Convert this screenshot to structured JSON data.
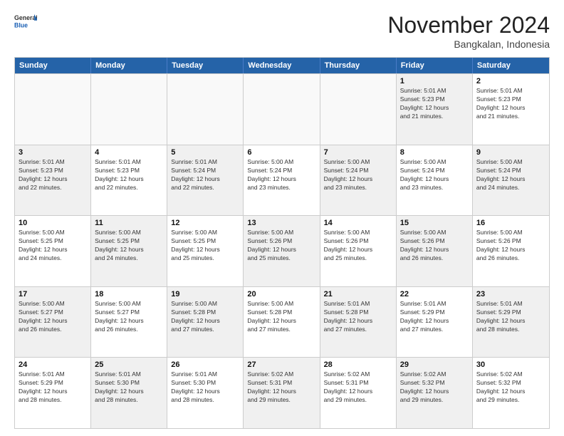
{
  "logo": {
    "general": "General",
    "blue": "Blue"
  },
  "title": "November 2024",
  "subtitle": "Bangkalan, Indonesia",
  "days": [
    "Sunday",
    "Monday",
    "Tuesday",
    "Wednesday",
    "Thursday",
    "Friday",
    "Saturday"
  ],
  "rows": [
    [
      {
        "num": "",
        "info": "",
        "empty": true
      },
      {
        "num": "",
        "info": "",
        "empty": true
      },
      {
        "num": "",
        "info": "",
        "empty": true
      },
      {
        "num": "",
        "info": "",
        "empty": true
      },
      {
        "num": "",
        "info": "",
        "empty": true
      },
      {
        "num": "1",
        "info": "Sunrise: 5:01 AM\nSunset: 5:23 PM\nDaylight: 12 hours\nand 21 minutes.",
        "shaded": true
      },
      {
        "num": "2",
        "info": "Sunrise: 5:01 AM\nSunset: 5:23 PM\nDaylight: 12 hours\nand 21 minutes.",
        "shaded": false
      }
    ],
    [
      {
        "num": "3",
        "info": "Sunrise: 5:01 AM\nSunset: 5:23 PM\nDaylight: 12 hours\nand 22 minutes.",
        "shaded": true
      },
      {
        "num": "4",
        "info": "Sunrise: 5:01 AM\nSunset: 5:23 PM\nDaylight: 12 hours\nand 22 minutes.",
        "shaded": false
      },
      {
        "num": "5",
        "info": "Sunrise: 5:01 AM\nSunset: 5:24 PM\nDaylight: 12 hours\nand 22 minutes.",
        "shaded": true
      },
      {
        "num": "6",
        "info": "Sunrise: 5:00 AM\nSunset: 5:24 PM\nDaylight: 12 hours\nand 23 minutes.",
        "shaded": false
      },
      {
        "num": "7",
        "info": "Sunrise: 5:00 AM\nSunset: 5:24 PM\nDaylight: 12 hours\nand 23 minutes.",
        "shaded": true
      },
      {
        "num": "8",
        "info": "Sunrise: 5:00 AM\nSunset: 5:24 PM\nDaylight: 12 hours\nand 23 minutes.",
        "shaded": false
      },
      {
        "num": "9",
        "info": "Sunrise: 5:00 AM\nSunset: 5:24 PM\nDaylight: 12 hours\nand 24 minutes.",
        "shaded": true
      }
    ],
    [
      {
        "num": "10",
        "info": "Sunrise: 5:00 AM\nSunset: 5:25 PM\nDaylight: 12 hours\nand 24 minutes.",
        "shaded": false
      },
      {
        "num": "11",
        "info": "Sunrise: 5:00 AM\nSunset: 5:25 PM\nDaylight: 12 hours\nand 24 minutes.",
        "shaded": true
      },
      {
        "num": "12",
        "info": "Sunrise: 5:00 AM\nSunset: 5:25 PM\nDaylight: 12 hours\nand 25 minutes.",
        "shaded": false
      },
      {
        "num": "13",
        "info": "Sunrise: 5:00 AM\nSunset: 5:26 PM\nDaylight: 12 hours\nand 25 minutes.",
        "shaded": true
      },
      {
        "num": "14",
        "info": "Sunrise: 5:00 AM\nSunset: 5:26 PM\nDaylight: 12 hours\nand 25 minutes.",
        "shaded": false
      },
      {
        "num": "15",
        "info": "Sunrise: 5:00 AM\nSunset: 5:26 PM\nDaylight: 12 hours\nand 26 minutes.",
        "shaded": true
      },
      {
        "num": "16",
        "info": "Sunrise: 5:00 AM\nSunset: 5:26 PM\nDaylight: 12 hours\nand 26 minutes.",
        "shaded": false
      }
    ],
    [
      {
        "num": "17",
        "info": "Sunrise: 5:00 AM\nSunset: 5:27 PM\nDaylight: 12 hours\nand 26 minutes.",
        "shaded": true
      },
      {
        "num": "18",
        "info": "Sunrise: 5:00 AM\nSunset: 5:27 PM\nDaylight: 12 hours\nand 26 minutes.",
        "shaded": false
      },
      {
        "num": "19",
        "info": "Sunrise: 5:00 AM\nSunset: 5:28 PM\nDaylight: 12 hours\nand 27 minutes.",
        "shaded": true
      },
      {
        "num": "20",
        "info": "Sunrise: 5:00 AM\nSunset: 5:28 PM\nDaylight: 12 hours\nand 27 minutes.",
        "shaded": false
      },
      {
        "num": "21",
        "info": "Sunrise: 5:01 AM\nSunset: 5:28 PM\nDaylight: 12 hours\nand 27 minutes.",
        "shaded": true
      },
      {
        "num": "22",
        "info": "Sunrise: 5:01 AM\nSunset: 5:29 PM\nDaylight: 12 hours\nand 27 minutes.",
        "shaded": false
      },
      {
        "num": "23",
        "info": "Sunrise: 5:01 AM\nSunset: 5:29 PM\nDaylight: 12 hours\nand 28 minutes.",
        "shaded": true
      }
    ],
    [
      {
        "num": "24",
        "info": "Sunrise: 5:01 AM\nSunset: 5:29 PM\nDaylight: 12 hours\nand 28 minutes.",
        "shaded": false
      },
      {
        "num": "25",
        "info": "Sunrise: 5:01 AM\nSunset: 5:30 PM\nDaylight: 12 hours\nand 28 minutes.",
        "shaded": true
      },
      {
        "num": "26",
        "info": "Sunrise: 5:01 AM\nSunset: 5:30 PM\nDaylight: 12 hours\nand 28 minutes.",
        "shaded": false
      },
      {
        "num": "27",
        "info": "Sunrise: 5:02 AM\nSunset: 5:31 PM\nDaylight: 12 hours\nand 29 minutes.",
        "shaded": true
      },
      {
        "num": "28",
        "info": "Sunrise: 5:02 AM\nSunset: 5:31 PM\nDaylight: 12 hours\nand 29 minutes.",
        "shaded": false
      },
      {
        "num": "29",
        "info": "Sunrise: 5:02 AM\nSunset: 5:32 PM\nDaylight: 12 hours\nand 29 minutes.",
        "shaded": true
      },
      {
        "num": "30",
        "info": "Sunrise: 5:02 AM\nSunset: 5:32 PM\nDaylight: 12 hours\nand 29 minutes.",
        "shaded": false
      }
    ]
  ]
}
